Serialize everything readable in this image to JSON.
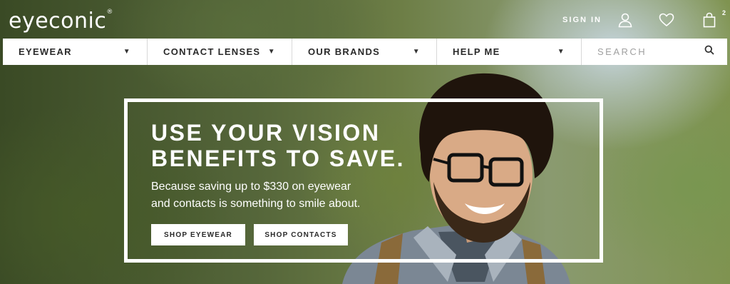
{
  "header": {
    "logo_text": "eyeconic",
    "logo_mark": "®",
    "sign_in_label": "SIGN IN",
    "bag_count": "2"
  },
  "nav": {
    "items": [
      {
        "label": "EYEWEAR"
      },
      {
        "label": "CONTACT LENSES"
      },
      {
        "label": "OUR BRANDS"
      },
      {
        "label": "HELP ME"
      }
    ],
    "search_placeholder": "SEARCH"
  },
  "hero": {
    "headline_line1": "USE YOUR VISION",
    "headline_line2": "BENEFITS TO SAVE.",
    "subtext_line1": "Because saving up to $330 on eyewear",
    "subtext_line2": "and contacts is something to smile about.",
    "cta_eyewear": "SHOP EYEWEAR",
    "cta_contacts": "SHOP CONTACTS"
  },
  "icons": {
    "user": "user-icon",
    "heart": "heart-icon",
    "bag": "shopping-bag-icon",
    "search": "search-icon",
    "caret": "chevron-down-icon"
  },
  "colors": {
    "nav_background": "#ffffff",
    "nav_text": "#2a2a2a",
    "hero_text": "#ffffff"
  }
}
